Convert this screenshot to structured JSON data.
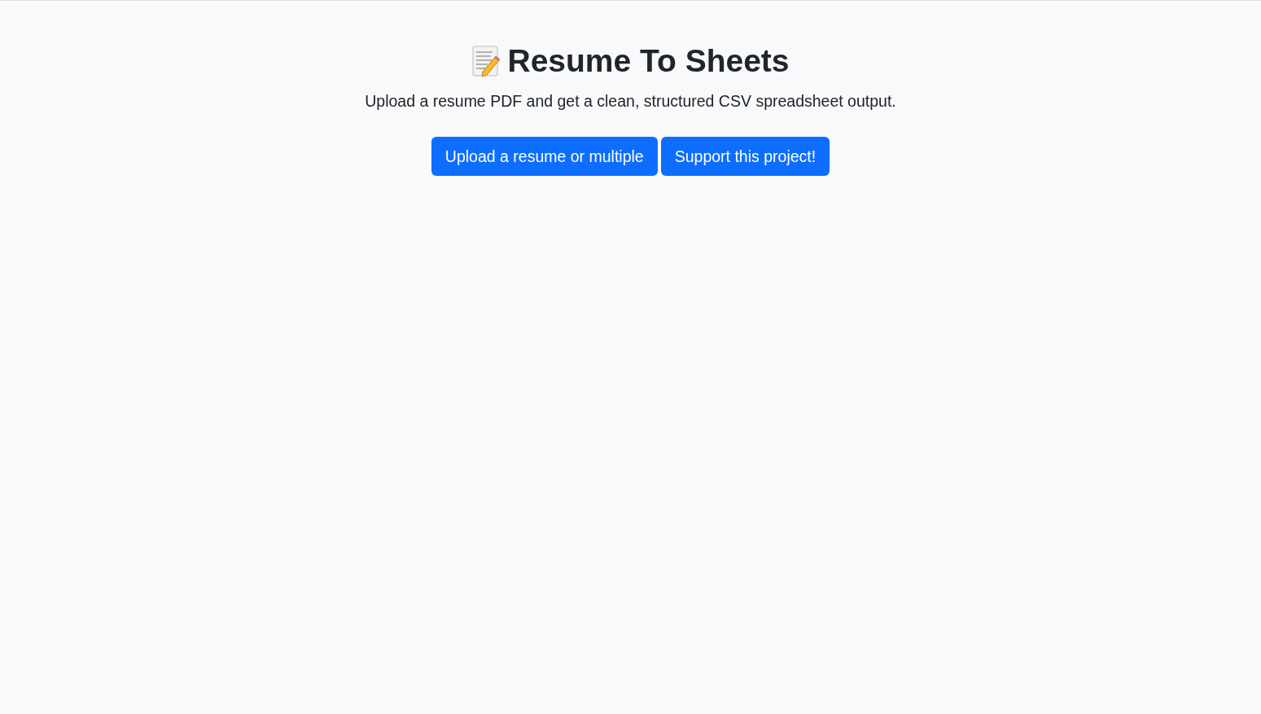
{
  "header": {
    "title": "Resume To Sheets",
    "subtitle": "Upload a resume PDF and get a clean, structured CSV spreadsheet output."
  },
  "buttons": [
    {
      "label": "Upload a resume or multiple"
    },
    {
      "label": "Support this project!"
    }
  ]
}
